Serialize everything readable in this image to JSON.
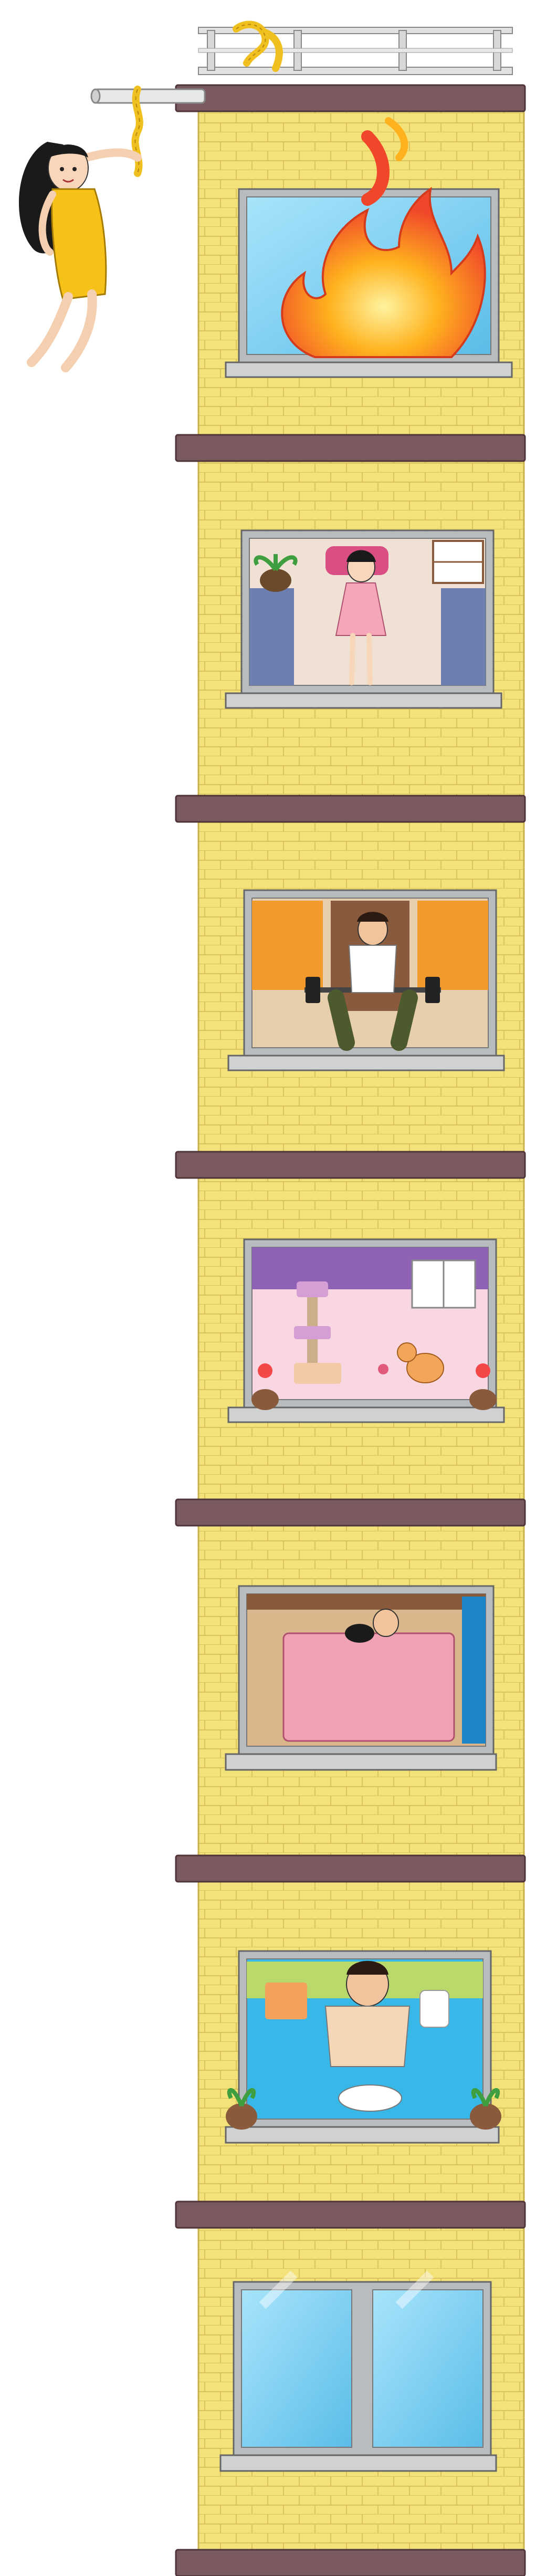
{
  "game": {
    "genre": "rescue puzzle",
    "floors_visible": 7,
    "objective_hint": ""
  },
  "colors": {
    "brick": "#f3e27a",
    "brick_line": "#d9c35a",
    "ledge": "#7a5a5f",
    "ledge_dark": "#5e4246",
    "window_frame": "#b9bcbf",
    "glass": "#8fd3f3",
    "roof_rail": "#d9d9d9",
    "rope": "#f0c020",
    "heroine_dress": "#f6c21a"
  },
  "floors": [
    {
      "index": 1,
      "name": "fire-room",
      "icon": "fire-icon"
    },
    {
      "index": 2,
      "name": "girl-bedroom",
      "icon": "girl-icon"
    },
    {
      "index": 3,
      "name": "gym-room",
      "icon": "barbell-icon"
    },
    {
      "index": 4,
      "name": "cat-room",
      "icon": "cat-icon"
    },
    {
      "index": 5,
      "name": "sleeping-room",
      "icon": "bed-icon"
    },
    {
      "index": 6,
      "name": "toilet-room",
      "icon": "toilet-icon"
    },
    {
      "index": 7,
      "name": "empty-window",
      "icon": "window-icon"
    }
  ]
}
